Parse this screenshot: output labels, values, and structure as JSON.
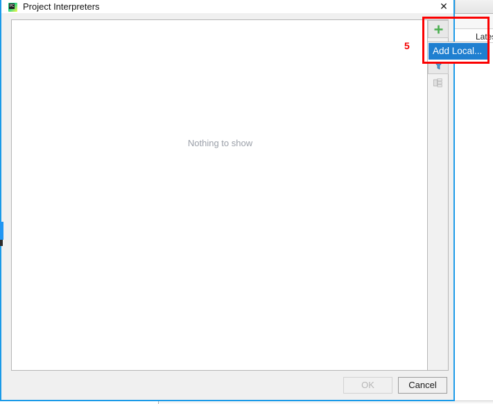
{
  "dialog": {
    "title": "Project Interpreters",
    "app_icon": "pycharm-icon",
    "icon_glyph": "PC",
    "close_icon": "✕",
    "empty_state_text": "Nothing to show"
  },
  "toolbar": {
    "buttons": [
      {
        "name": "add-interpreter-button",
        "icon": "plus-icon",
        "enabled": true,
        "color": "#4caf50"
      },
      {
        "name": "edit-interpreter-button",
        "icon": "pencil-icon",
        "enabled": false,
        "color": "#b0b0b0"
      },
      {
        "name": "filter-button",
        "icon": "funnel-icon",
        "enabled": true,
        "color": "#3d8fd1"
      },
      {
        "name": "show-paths-button",
        "icon": "copy-paths-icon",
        "enabled": false,
        "color": "#b5b5b5"
      }
    ]
  },
  "popup_menu": {
    "items": [
      {
        "label": "Add Local...",
        "selected": true
      }
    ]
  },
  "buttons": {
    "ok_label": "OK",
    "ok_enabled": false,
    "cancel_label": "Cancel",
    "cancel_enabled": true
  },
  "background_window": {
    "table_column_header": "Lates"
  },
  "annotations": {
    "step_number": "5",
    "highlight_color": "#fb0000"
  }
}
